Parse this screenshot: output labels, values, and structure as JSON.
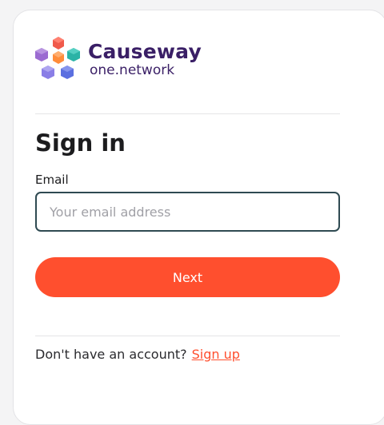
{
  "brand": {
    "name": "Causeway",
    "subname": "one.network",
    "logo_icon": "causeway-cubes-logo",
    "colors": {
      "red": "#f05a4b",
      "orange": "#ff8c3a",
      "purple": "#9b6bd1",
      "teal": "#2bb3a6",
      "blue": "#6e73e6"
    }
  },
  "form": {
    "title": "Sign in",
    "email_label": "Email",
    "email_placeholder": "Your email address",
    "email_value": "",
    "next_label": "Next"
  },
  "footer": {
    "prompt": "Don't have an account?",
    "signup_label": "Sign up"
  },
  "colors": {
    "accent": "#ff4f2e",
    "input_border": "#2f4a52",
    "brand_text": "#3a1f66"
  }
}
